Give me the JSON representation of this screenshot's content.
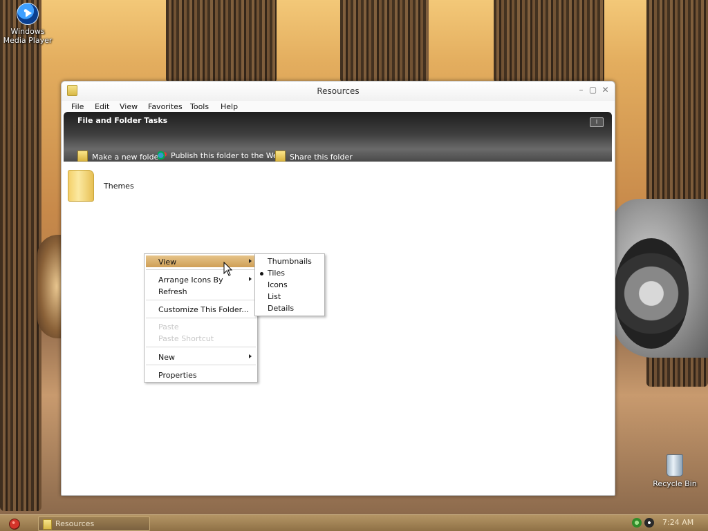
{
  "desktop": {
    "icons": [
      {
        "label_line1": "Windows",
        "label_line2": "Media Player",
        "icon": "windows-media-player-icon"
      },
      {
        "label_line1": "Recycle Bin",
        "label_line2": "",
        "icon": "recycle-bin-icon"
      }
    ]
  },
  "window": {
    "title": "Resources",
    "menu": [
      "File",
      "Edit",
      "View",
      "Favorites",
      "Tools",
      "Help"
    ],
    "taskpane": {
      "title": "File and Folder Tasks",
      "tasks": [
        "Make a new folder",
        "Publish this folder to the Web",
        "Share this folder"
      ]
    },
    "items": [
      {
        "label": "Themes",
        "icon": "folder-icon"
      }
    ]
  },
  "context_menu": {
    "items": [
      {
        "label": "View",
        "has_submenu": true,
        "highlighted": true,
        "disabled": false
      },
      {
        "label": "Arrange Icons By",
        "has_submenu": true,
        "disabled": false
      },
      {
        "label": "Refresh",
        "has_submenu": false,
        "disabled": false
      },
      {
        "label": "Customize This Folder...",
        "has_submenu": false,
        "disabled": false
      },
      {
        "label": "Paste",
        "has_submenu": false,
        "disabled": true
      },
      {
        "label": "Paste Shortcut",
        "has_submenu": false,
        "disabled": true
      },
      {
        "label": "New",
        "has_submenu": true,
        "disabled": false
      },
      {
        "label": "Properties",
        "has_submenu": false,
        "disabled": false
      }
    ]
  },
  "view_submenu": {
    "items": [
      "Thumbnails",
      "Tiles",
      "Icons",
      "List",
      "Details"
    ],
    "selected": "Tiles"
  },
  "taskbar": {
    "task_label": "Resources",
    "clock": "7:24 AM"
  },
  "colors": {
    "menu_highlight": "#d9ad66",
    "taskbar": "#a3865a",
    "taskpane": "#3a3a3a"
  }
}
